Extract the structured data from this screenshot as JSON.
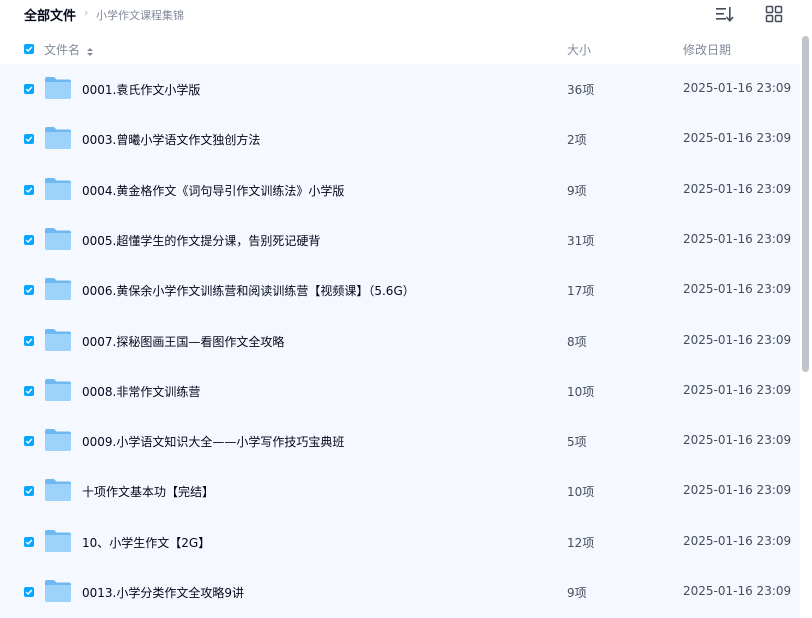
{
  "breadcrumb": {
    "root": "全部文件",
    "separator": "›",
    "current": "小学作文课程集锦"
  },
  "toolbar": {
    "sort_icon": "sort-list-icon",
    "view_icon": "grid-view-icon"
  },
  "header": {
    "name": "文件名",
    "size": "大小",
    "modified": "修改日期"
  },
  "rows": [
    {
      "name": "0001.袁氏作文小学版",
      "size": "36项",
      "date": "2025-01-16 23:09",
      "checked": true
    },
    {
      "name": "0003.曾曦小学语文作文独创方法",
      "size": "2项",
      "date": "2025-01-16 23:09",
      "checked": true
    },
    {
      "name": "0004.黄金格作文《词句导引作文训练法》小学版",
      "size": "9项",
      "date": "2025-01-16 23:09",
      "checked": true
    },
    {
      "name": "0005.超懂学生的作文提分课，告别死记硬背",
      "size": "31项",
      "date": "2025-01-16 23:09",
      "checked": true
    },
    {
      "name": "0006.黄保余小学作文训练营和阅读训练营【视频课】（5.6G）",
      "size": "17项",
      "date": "2025-01-16 23:09",
      "checked": true
    },
    {
      "name": "0007.探秘图画王国—看图作文全攻略",
      "size": "8项",
      "date": "2025-01-16 23:09",
      "checked": true
    },
    {
      "name": "0008.非常作文训练营",
      "size": "10项",
      "date": "2025-01-16 23:09",
      "checked": true
    },
    {
      "name": "0009.小学语文知识大全——小学写作技巧宝典班",
      "size": "5项",
      "date": "2025-01-16 23:09",
      "checked": true
    },
    {
      "name": "十项作文基本功【完结】",
      "size": "10项",
      "date": "2025-01-16 23:09",
      "checked": true
    },
    {
      "name": "10、小学生作文【2G】",
      "size": "12项",
      "date": "2025-01-16 23:09",
      "checked": true
    },
    {
      "name": "0013.小学分类作文全攻略9讲",
      "size": "9项",
      "date": "2025-01-16 23:09",
      "checked": true
    }
  ],
  "colors": {
    "accent": "#06a7ff",
    "selected_bg": "#f5f8ff",
    "folder": "#7ec3f5"
  }
}
